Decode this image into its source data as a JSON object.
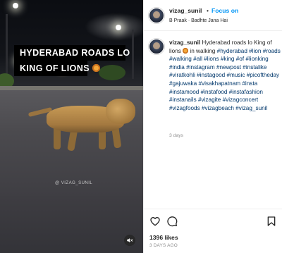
{
  "video": {
    "overlay_line1": "HYDERABAD ROADS LO",
    "overlay_line2": "KING OF LIONS",
    "overlay_emoji": "lion-emoji",
    "watermark": "@ VIZAG_SUNIL",
    "mute_icon": "speaker-muted-icon"
  },
  "header": {
    "username": "vizag_sunil",
    "separator": "•",
    "follow_label": "Focus on",
    "audio": "B Praak · Badhte Jana Hai"
  },
  "caption": {
    "username": "vizag_sunil",
    "text_before_emoji": "Hyderabad roads lo King of lions",
    "text_after_emoji": "in walking",
    "hashtags": [
      "#hyderabad",
      "#lion",
      "#roads",
      "#walking",
      "#all",
      "#lions",
      "#king",
      "#of",
      "#lionking",
      "#india",
      "#instagram",
      "#newpost",
      "#instalike",
      "#viratkohli",
      "#instagood",
      "#music",
      "#picoftheday",
      "#gajuwaka",
      "#visakhapatnam",
      "#insta",
      "#instamood",
      "#instafood",
      "#instafashion",
      "#instanails",
      "#vizagite",
      "#vizagconcert",
      "#vizagfoods",
      "#vizagbeach",
      "#vizag_sunil"
    ],
    "time": "3 days"
  },
  "actions": {
    "like_icon": "heart-icon",
    "comment_icon": "comment-icon",
    "save_icon": "bookmark-icon",
    "likes": "1396 likes",
    "posted": "3 DAYS AGO"
  },
  "colors": {
    "follow_blue": "#0095f6",
    "hashtag_blue": "#00376b",
    "muted_text": "#8e8e8e"
  }
}
